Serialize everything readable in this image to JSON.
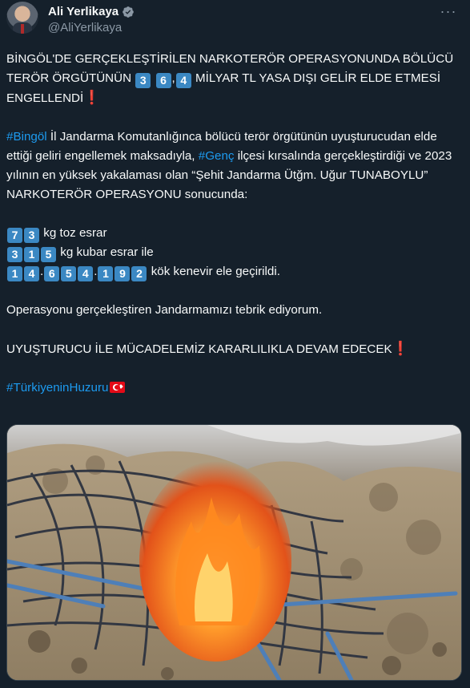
{
  "author": {
    "display_name": "Ali Yerlikaya",
    "handle": "@AliYerlikaya",
    "verified": true,
    "avatar_icon": "profile-photo"
  },
  "more_label": "···",
  "tweet": {
    "p1_a": "BİNGÖL'DE GERÇEKLEŞTİRİLEN NARKOTERÖR OPERASYONUNDA BÖLÜCÜ TERÖR ÖRGÜTÜNÜN ",
    "p1_key1": "3",
    "p1_key2": "6",
    "p1_sep": ",",
    "p1_key3": "4",
    "p1_b": " MİLYAR TL YASA DIŞI GELİR ELDE ETMESİ ENGELLENDİ",
    "exclaim": "❗",
    "hashtag_bingol": "#Bingöl",
    "p2_a": " İl Jandarma Komutanlığınca bölücü terör örgütünün uyuşturucudan elde ettiği geliri engellemek maksadıyla, ",
    "hashtag_genc": "#Genç",
    "p2_b": " ilçesi kırsalında gerçekleştirdiği ve 2023 yılının en yüksek yakalaması olan “Şehit Jandarma Ütğm. Uğur TUNABOYLU” NARKOTERÖR OPERASYONU sonucunda:",
    "line1_keys": [
      "7",
      "3"
    ],
    "line1_text": " kg toz esrar",
    "line2_keys": [
      "3",
      "1",
      "5"
    ],
    "line2_text": " kg kubar esrar ile",
    "line3_keys_a": [
      "1",
      "4"
    ],
    "line3_keys_b": [
      "6",
      "5",
      "4"
    ],
    "line3_keys_c": [
      "1",
      "9",
      "2"
    ],
    "line3_dot": ".",
    "line3_text": " kök kenevir ele geçirildi.",
    "p4": "Operasyonu gerçekleştiren Jandarmamızı tebrik ediyorum.",
    "p5": "UYUŞTURUCU İLE MÜCADELEMİZ KARARLILIKLA DEVAM EDECEK",
    "hashtag_huzur": "#TürkiyeninHuzuru"
  },
  "media": {
    "description_icon": "burning-cannabis-pile-photo"
  },
  "colors": {
    "background": "#15202b",
    "text": "#f7f9f9",
    "secondary": "#8b98a5",
    "link": "#1d9bf0",
    "keycap": "#3b88c3",
    "alert": "#e0242f"
  }
}
